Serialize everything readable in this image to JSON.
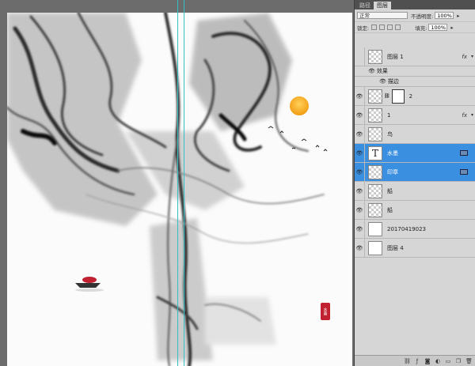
{
  "panel": {
    "tabs": [
      {
        "label": "路径"
      },
      {
        "label": "图层"
      }
    ],
    "blend_mode": "正常",
    "opacity_label": "不透明度:",
    "opacity_value": "100%",
    "fill_label": "填充:",
    "fill_value": "100%",
    "lock_label": "锁定:"
  },
  "layers": [
    {
      "name": "图层 1",
      "fx": "fx"
    },
    {
      "name": "效果"
    },
    {
      "name": "描边"
    },
    {
      "name": "2"
    },
    {
      "name": "1",
      "fx": "fx"
    },
    {
      "name": "鸟"
    },
    {
      "name": "水墨",
      "thumb": "T"
    },
    {
      "name": "印章"
    },
    {
      "name": "船"
    },
    {
      "name": "船"
    },
    {
      "name": "20170419023"
    },
    {
      "name": "图层 4"
    }
  ],
  "seal_text": "水墨",
  "colors": {
    "selection": "#3b8fe0",
    "guide": "#33c2c2",
    "sun": "#f5a81c",
    "seal": "#c02030"
  }
}
